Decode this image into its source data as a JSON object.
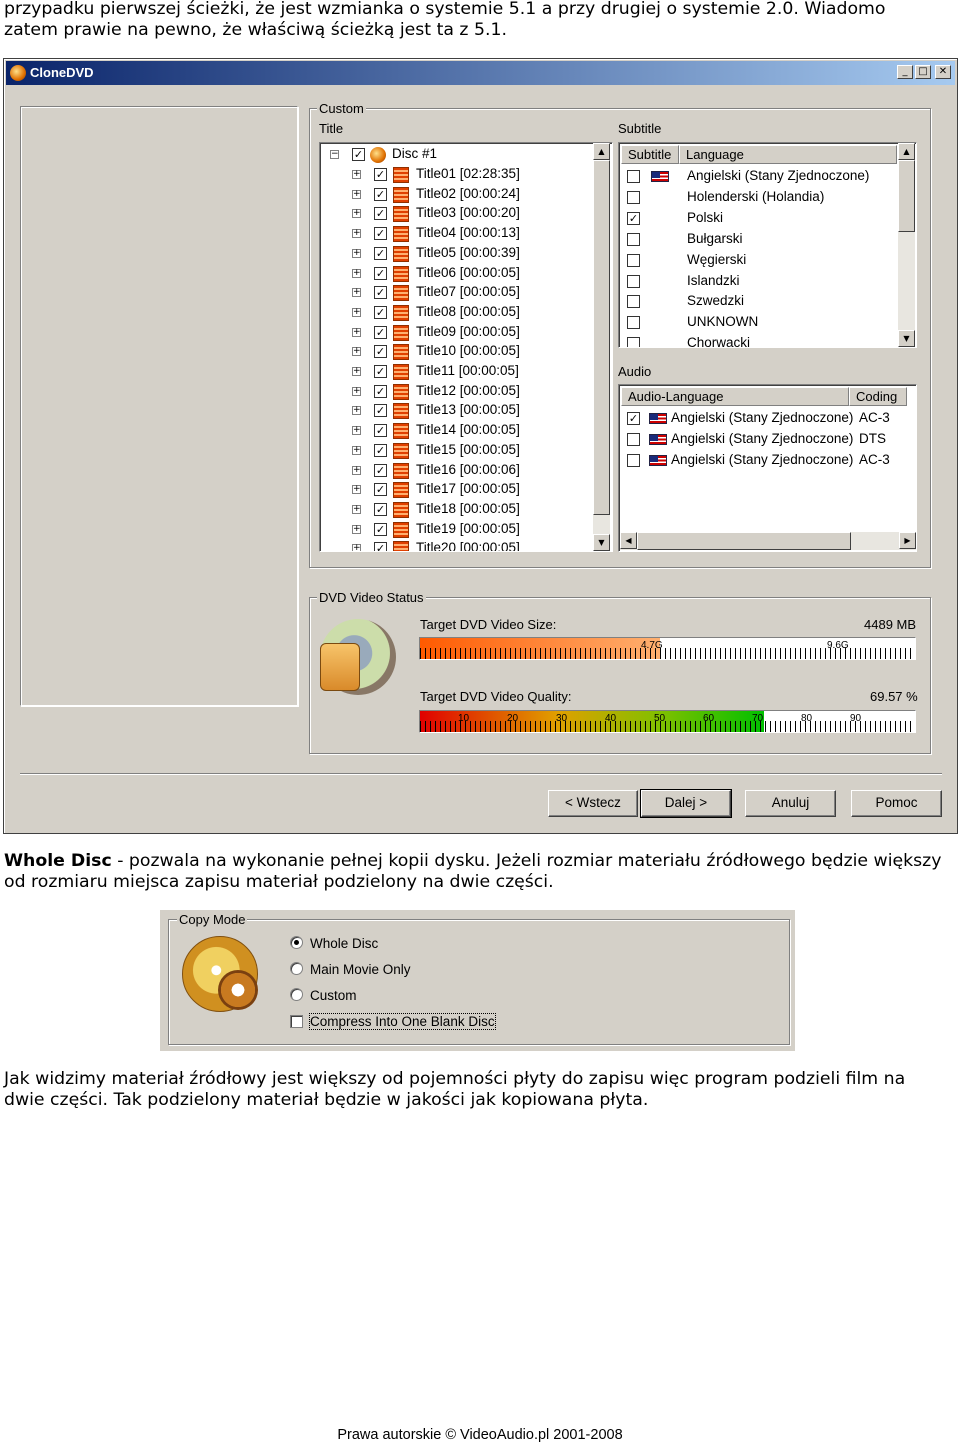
{
  "intro_text": "przypadku pierwszej ścieżki, że jest wzmianka o systemie 5.1 a przy drugiej o systemie 2.0. Wiadomo zatem prawie na pewno, że właściwą ścieżką jest ta z 5.1.",
  "window": {
    "title": "CloneDVD",
    "custom_group": "Custom",
    "title_label": "Title",
    "disc_label": "Disc #1",
    "titles": [
      "Title01 [02:28:35]",
      "Title02 [00:00:24]",
      "Title03 [00:00:20]",
      "Title04 [00:00:13]",
      "Title05 [00:00:39]",
      "Title06 [00:00:05]",
      "Title07 [00:00:05]",
      "Title08 [00:00:05]",
      "Title09 [00:00:05]",
      "Title10 [00:00:05]",
      "Title11 [00:00:05]",
      "Title12 [00:00:05]",
      "Title13 [00:00:05]",
      "Title14 [00:00:05]",
      "Title15 [00:00:05]",
      "Title16 [00:00:06]",
      "Title17 [00:00:05]",
      "Title18 [00:00:05]",
      "Title19 [00:00:05]",
      "Title20 [00:00:05]"
    ],
    "subtitle_label": "Subtitle",
    "subtitle_columns": [
      "Subtitle",
      "Language"
    ],
    "subtitles": [
      {
        "language": "Angielski (Stany Zjednoczone)",
        "checked": false,
        "flag": true
      },
      {
        "language": "Holenderski (Holandia)",
        "checked": false,
        "flag": false
      },
      {
        "language": "Polski",
        "checked": true,
        "flag": false
      },
      {
        "language": "Bułgarski",
        "checked": false,
        "flag": false
      },
      {
        "language": "Węgierski",
        "checked": false,
        "flag": false
      },
      {
        "language": "Islandzki",
        "checked": false,
        "flag": false
      },
      {
        "language": "Szwedzki",
        "checked": false,
        "flag": false
      },
      {
        "language": "UNKNOWN",
        "checked": false,
        "flag": false
      },
      {
        "language": "Chorwacki",
        "checked": false,
        "flag": false
      }
    ],
    "audio_label": "Audio",
    "audio_columns": [
      "Audio-Language",
      "Coding"
    ],
    "audio": [
      {
        "language": "Angielski (Stany Zjednoczone)",
        "coding": "AC-3",
        "checked": true
      },
      {
        "language": "Angielski (Stany Zjednoczone)",
        "coding": "DTS",
        "checked": false
      },
      {
        "language": "Angielski (Stany Zjednoczone)",
        "coding": "AC-3",
        "checked": false
      }
    ],
    "status_group": "DVD Video Status",
    "size_label": "Target DVD Video Size:",
    "size_value": "4489 MB",
    "size_fraction": 0.485,
    "size_marks": [
      "4.7G",
      "9.6G"
    ],
    "quality_label": "Target DVD Video Quality:",
    "quality_value": "69.57 %",
    "quality_fraction": 0.6957,
    "quality_marks": [
      "10",
      "20",
      "30",
      "40",
      "50",
      "60",
      "70",
      "80",
      "90"
    ],
    "buttons": {
      "back": "< Wstecz",
      "next": "Dalej >",
      "cancel": "Anuluj",
      "help": "Pomoc"
    }
  },
  "whole_disc_term": "Whole Disc",
  "whole_disc_text": " - pozwala na wykonanie pełnej kopii dysku. Jeżeli rozmiar materiału źródłowego będzie większy od rozmiaru miejsca zapisu materiał podzielony na dwie części.",
  "copy_mode": {
    "group": "Copy Mode",
    "options": [
      "Whole Disc",
      "Main Movie Only",
      "Custom"
    ],
    "selected": 0,
    "compress_label": "Compress Into One Blank Disc",
    "compress_checked": false
  },
  "outro_text": "Jak widzimy materiał źródłowy jest większy od pojemności płyty do zapisu więc program podzieli film na dwie części. Tak podzielony materiał będzie w jakości jak kopiowana płyta.",
  "footer": "Prawa autorskie © VideoAudio.pl 2001-2008",
  "colors": {
    "titlebar_start": "#0a246a",
    "titlebar_end": "#a6caf0",
    "window_bg": "#d4d0c8"
  }
}
